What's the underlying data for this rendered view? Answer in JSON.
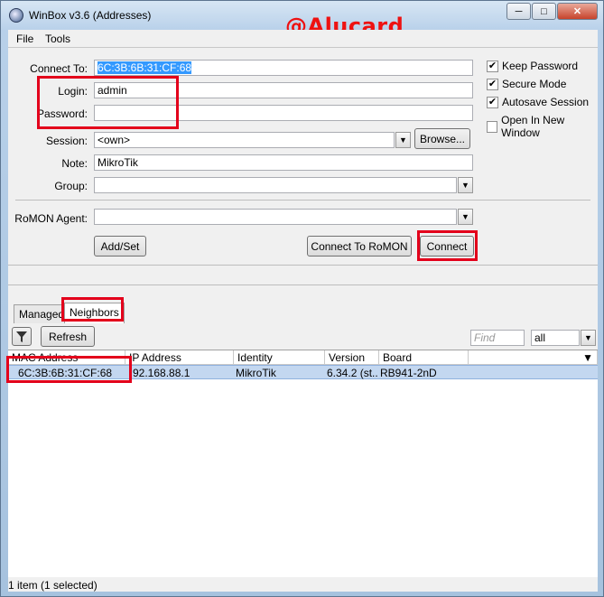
{
  "window": {
    "title": "WinBox v3.6 (Addresses)",
    "watermark": "@Alucard"
  },
  "menu": {
    "file": "File",
    "tools": "Tools"
  },
  "form": {
    "connect_to_label": "Connect To:",
    "connect_to_value": "6C:3B:6B:31:CF:68",
    "login_label": "Login:",
    "login_value": "admin",
    "password_label": "Password:",
    "password_value": "",
    "session_label": "Session:",
    "session_value": "<own>",
    "browse_label": "Browse...",
    "note_label": "Note:",
    "note_value": "MikroTik",
    "group_label": "Group:",
    "group_value": "",
    "romon_label": "RoMON Agent:",
    "romon_value": "",
    "addset_label": "Add/Set",
    "connect_romon_label": "Connect To RoMON",
    "connect_label": "Connect"
  },
  "options": {
    "keep_password": {
      "label": "Keep Password",
      "checked": true
    },
    "secure_mode": {
      "label": "Secure Mode",
      "checked": true
    },
    "autosave_session": {
      "label": "Autosave Session",
      "checked": true
    },
    "open_new_window": {
      "label": "Open In New Window",
      "checked": false
    }
  },
  "tabs": {
    "managed": "Managed",
    "neighbors": "Neighbors"
  },
  "toolbar": {
    "refresh": "Refresh",
    "find_placeholder": "Find",
    "filter_value": "all"
  },
  "table": {
    "headers": [
      "MAC Address",
      "IP Address",
      "Identity",
      "Version",
      "Board"
    ],
    "rows": [
      [
        "6C:3B:6B:31:CF:68",
        "92.168.88.1",
        "MikroTik",
        "6.34.2 (st...",
        "RB941-2nD"
      ]
    ]
  },
  "status": "1 item (1 selected)",
  "colors": {
    "highlight": "#e3001b",
    "selection": "#c3d7f0"
  }
}
